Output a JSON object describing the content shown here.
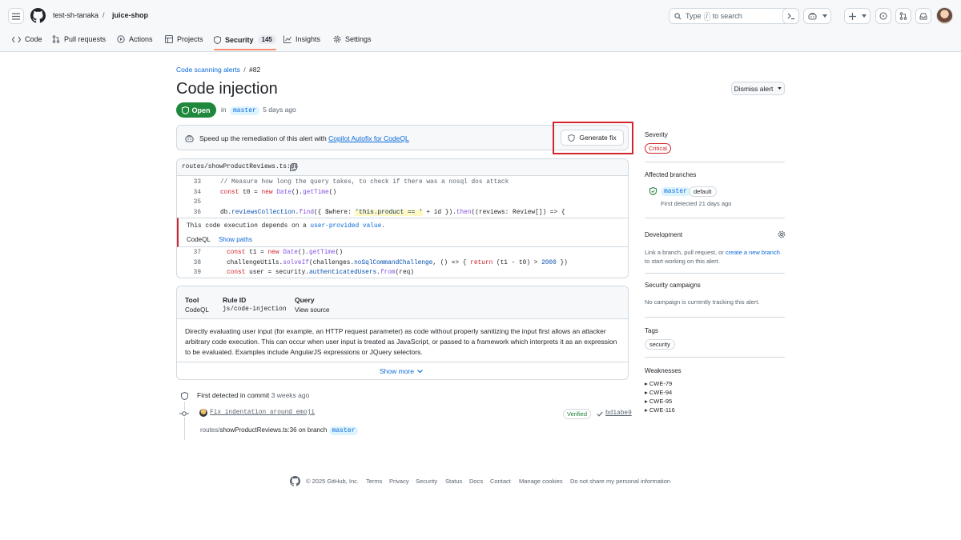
{
  "header": {
    "owner": "test-sh-tanaka",
    "separator": "/",
    "repo": "juice-shop",
    "search_prefix": "Type",
    "search_key": "/",
    "search_suffix": "to search"
  },
  "tabs": [
    {
      "label": "Code",
      "icon": "code-icon"
    },
    {
      "label": "Pull requests",
      "icon": "pull-request-icon"
    },
    {
      "label": "Actions",
      "icon": "play-icon"
    },
    {
      "label": "Projects",
      "icon": "table-icon"
    },
    {
      "label": "Security",
      "icon": "shield-icon",
      "count": "145",
      "selected": true
    },
    {
      "label": "Insights",
      "icon": "graph-icon"
    },
    {
      "label": "Settings",
      "icon": "gear-icon"
    }
  ],
  "breadcrumb": {
    "link": "Code scanning alerts",
    "sep": "/",
    "current": "#82"
  },
  "alert": {
    "title": "Code injection",
    "status": "Open",
    "in_label": "in",
    "branch": "master",
    "age": "5 days ago",
    "dismiss_label": "Dismiss alert"
  },
  "autofix": {
    "text": "Speed up the remediation of this alert with",
    "link": "Copilot Autofix for CodeQL",
    "button": "Generate fix",
    "highlight_color": "#d1242f"
  },
  "code": {
    "file_dir": "routes/",
    "file_name": "showProductReviews.ts",
    "file_line": ":36",
    "lines_top": [
      {
        "n": "33",
        "text": "// Measure how long the query takes, to check if there was a nosql dos attack"
      },
      {
        "n": "34",
        "text": "const t0 = new Date().getTime()"
      },
      {
        "n": "35",
        "text": ""
      },
      {
        "n": "36",
        "text": "db.reviewsCollection.find({ $where: 'this.product == ' + id }).then((reviews: Review[]) => {"
      }
    ],
    "message_prefix": "This code execution depends on a",
    "message_link": "user-provided value",
    "message_suffix": ".",
    "tool": "CodeQL",
    "show_paths": "Show paths",
    "lines_bottom": [
      {
        "n": "37",
        "text": "const t1 = new Date().getTime()"
      },
      {
        "n": "38",
        "text": "challengeUtils.solveIf(challenges.noSqlCommandChallenge, () => { return (t1 - t0) > 2000 })"
      },
      {
        "n": "39",
        "text": "const user = security.authenticatedUsers.from(req)"
      }
    ]
  },
  "details": {
    "tool_h": "Tool",
    "tool_v": "CodeQL",
    "rule_h": "Rule ID",
    "rule_v": "js/code-injection",
    "query_h": "Query",
    "query_v": "View source",
    "description": "Directly evaluating user input (for example, an HTTP request parameter) as code without properly sanitizing the input first allows an attacker arbitrary code execution. This can occur when user input is treated as JavaScript, or passed to a framework which interprets it as an expression to be evaluated. Examples include AngularJS expressions or JQuery selectors.",
    "show_more": "Show more"
  },
  "timeline": {
    "first_detected_label": "First detected in commit",
    "first_detected_age": "3 weeks ago",
    "commit_msg": "Fix indentation around emoji",
    "verified": "Verified",
    "sha": "bd1abe9",
    "path_dir": "routes/",
    "path_file": "showProductReviews.ts:36",
    "on_branch": "on branch",
    "branch": "master"
  },
  "sidebar": {
    "severity_h": "Severity",
    "severity_v": "Critical",
    "affected_h": "Affected branches",
    "affected_branch": "master",
    "affected_default": "default",
    "affected_first": "First detected 21 days ago",
    "dev_h": "Development",
    "dev_t1": "Link a branch, pull request, or",
    "dev_link": "create a new branch",
    "dev_t2": "to start working on this alert.",
    "camp_h": "Security campaigns",
    "camp_t": "No campaign is currently tracking this alert.",
    "tags_h": "Tags",
    "tag": "security",
    "weak_h": "Weaknesses",
    "weaknesses": [
      "CWE-79",
      "CWE-94",
      "CWE-95",
      "CWE-116"
    ]
  },
  "footer": {
    "copyright": "© 2025 GitHub, Inc.",
    "links": [
      "Terms",
      "Privacy",
      "Security",
      "Status",
      "Docs",
      "Contact",
      "Manage cookies",
      "Do not share my personal information"
    ]
  }
}
